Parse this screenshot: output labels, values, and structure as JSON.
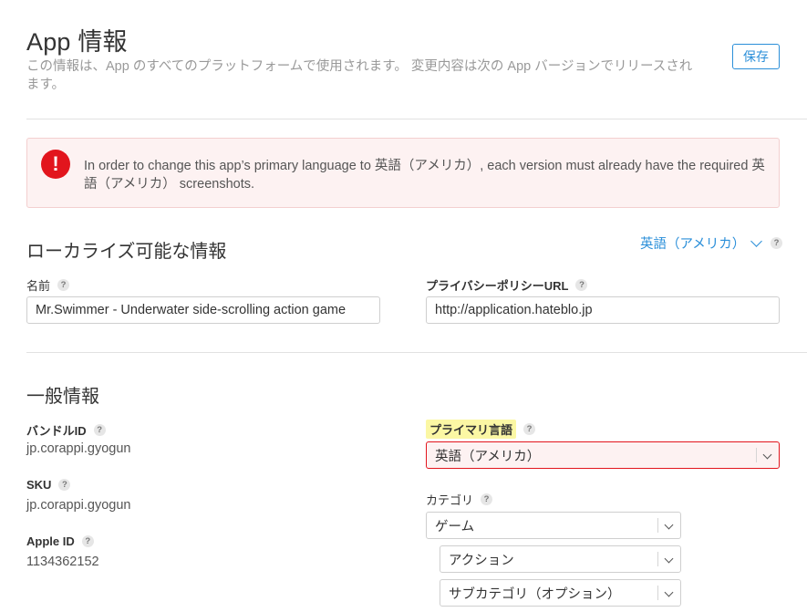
{
  "header": {
    "title": "App 情報",
    "description": "この情報は、App のすべてのプラットフォームで使用されます。 変更内容は次の App バージョンでリリースされます。",
    "save_label": "保存"
  },
  "alert": {
    "icon": "error-icon",
    "icon_glyph": "!",
    "message": "In order to change this app’s primary language to 英語（アメリカ）, each version must already have the required 英語（アメリカ） screenshots."
  },
  "localizable": {
    "title": "ローカライズ可能な情報",
    "language": "英語（アメリカ）",
    "name_label": "名前",
    "name_value": "Mr.Swimmer - Underwater side-scrolling action game",
    "privacy_label": "プライバシーポリシーURL",
    "privacy_value": "http://application.hateblo.jp"
  },
  "general": {
    "title": "一般情報",
    "bundle_label": "バンドルID",
    "bundle_value": "jp.corappi.gyogun",
    "sku_label": "SKU",
    "sku_value": "jp.corappi.gyogun",
    "appleid_label": "Apple ID",
    "appleid_value": "1134362152",
    "primary_lang_label": "プライマリ言語",
    "primary_lang_value": "英語（アメリカ）",
    "category_label": "カテゴリ",
    "category_value": "ゲーム",
    "subcategory1_value": "アクション",
    "subcategory2_value": "サブカテゴリ（オプション）"
  },
  "help_glyph": "?",
  "colors": {
    "accent": "#2b8fd9",
    "error": "#e2151d",
    "error_bg": "#fdf2f2",
    "highlight": "#fbf7a4"
  }
}
